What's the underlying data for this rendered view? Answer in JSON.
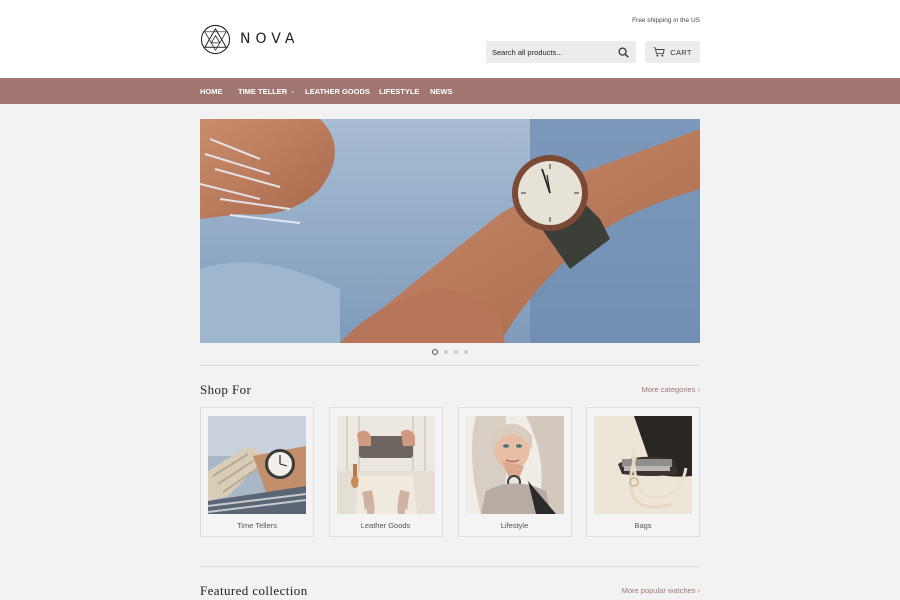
{
  "header": {
    "brand": "NOVA",
    "shipping_note": "Free shipping in the US",
    "search_placeholder": "Search all products...",
    "cart_label": "CART"
  },
  "nav": {
    "items": [
      {
        "label": "HOME"
      },
      {
        "label": "TIME TELLER",
        "has_dropdown": true
      },
      {
        "label": "LEATHER GOODS"
      },
      {
        "label": "LIFESTYLE"
      },
      {
        "label": "NEWS"
      }
    ]
  },
  "slideshow": {
    "slide_count": 4,
    "active_index": 0
  },
  "shop_for": {
    "title": "Shop For",
    "more_link": "More categories ›",
    "categories": [
      {
        "label": "Time Tellers"
      },
      {
        "label": "Leather Goods"
      },
      {
        "label": "Lifestyle"
      },
      {
        "label": "Bags"
      }
    ]
  },
  "featured": {
    "title": "Featured collection",
    "more_link": "More popular watches ›"
  },
  "colors": {
    "nav_background": "#a17671",
    "link_accent": "#a17671",
    "page_background": "#f2f2f2"
  }
}
